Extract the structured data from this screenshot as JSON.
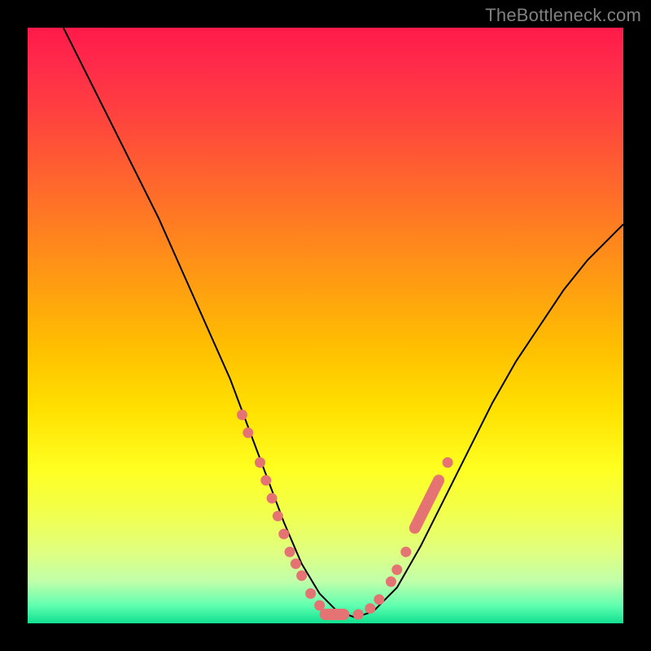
{
  "watermark": "TheBottleneck.com",
  "colors": {
    "background": "#000000",
    "gradient_top": "#ff1a4a",
    "gradient_bottom": "#10e090",
    "curve": "#000000",
    "marker": "#e57373"
  },
  "chart_data": {
    "type": "line",
    "title": "",
    "xlabel": "",
    "ylabel": "",
    "xlim": [
      0,
      100
    ],
    "ylim": [
      0,
      100
    ],
    "series": [
      {
        "name": "bottleneck-curve",
        "x": [
          6,
          10,
          14,
          18,
          22,
          26,
          30,
          34,
          37,
          40,
          43,
          46,
          49,
          52,
          55,
          58,
          62,
          66,
          70,
          74,
          78,
          82,
          86,
          90,
          94,
          98,
          100
        ],
        "y": [
          100,
          92,
          84,
          76,
          68,
          59,
          50,
          41,
          33,
          25,
          17,
          10,
          5,
          2,
          1,
          2,
          6,
          13,
          21,
          29,
          37,
          44,
          50,
          56,
          61,
          65,
          67
        ]
      }
    ],
    "markers": {
      "left_cluster": [
        {
          "x": 36,
          "y": 35
        },
        {
          "x": 37,
          "y": 32
        },
        {
          "x": 39,
          "y": 27
        },
        {
          "x": 40,
          "y": 24
        },
        {
          "x": 41,
          "y": 21
        },
        {
          "x": 42,
          "y": 18
        },
        {
          "x": 43,
          "y": 15
        },
        {
          "x": 44,
          "y": 12
        },
        {
          "x": 45,
          "y": 10
        },
        {
          "x": 46,
          "y": 8
        },
        {
          "x": 47.5,
          "y": 5
        },
        {
          "x": 49,
          "y": 3
        }
      ],
      "bottom_bar_left": {
        "x_start": 49,
        "x_end": 54,
        "y": 1.5
      },
      "bottom_dots": [
        {
          "x": 55.5,
          "y": 1.5
        },
        {
          "x": 57.5,
          "y": 2.5
        },
        {
          "x": 59,
          "y": 4
        }
      ],
      "right_cluster": [
        {
          "x": 61,
          "y": 7
        },
        {
          "x": 62,
          "y": 9
        },
        {
          "x": 63.5,
          "y": 12
        }
      ],
      "right_bar": {
        "x_start": 65,
        "x_end": 69,
        "y_start": 16,
        "y_end": 24
      },
      "right_top_dot": {
        "x": 70.5,
        "y": 27
      }
    }
  }
}
